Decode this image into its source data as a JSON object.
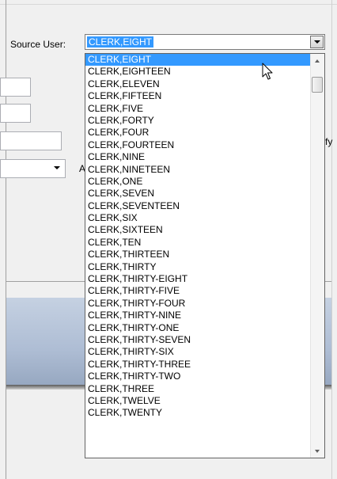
{
  "form": {
    "source_user_label": "Source User:",
    "partial_letter_a": "A",
    "partial_text_fy": "fy"
  },
  "source_user_combo": {
    "selected_value": "CLERK,EIGHT"
  },
  "dropdown": {
    "items": [
      "CLERK,EIGHT",
      "CLERK,EIGHTEEN",
      "CLERK,ELEVEN",
      "CLERK,FIFTEEN",
      "CLERK,FIVE",
      "CLERK,FORTY",
      "CLERK,FOUR",
      "CLERK,FOURTEEN",
      "CLERK,NINE",
      "CLERK,NINETEEN",
      "CLERK,ONE",
      "CLERK,SEVEN",
      "CLERK,SEVENTEEN",
      "CLERK,SIX",
      "CLERK,SIXTEEN",
      "CLERK,TEN",
      "CLERK,THIRTEEN",
      "CLERK,THIRTY",
      "CLERK,THIRTY-EIGHT",
      "CLERK,THIRTY-FIVE",
      "CLERK,THIRTY-FOUR",
      "CLERK,THIRTY-NINE",
      "CLERK,THIRTY-ONE",
      "CLERK,THIRTY-SEVEN",
      "CLERK,THIRTY-SIX",
      "CLERK,THIRTY-THREE",
      "CLERK,THIRTY-TWO",
      "CLERK,THREE",
      "CLERK,TWELVE",
      "CLERK,TWENTY"
    ],
    "highlighted_index": 0
  },
  "colors": {
    "selection": "#3399ff",
    "window_bg": "#f0f0f0",
    "panel_band": "#aebdd4"
  },
  "icons": {
    "combo_arrow": "chevron-down-icon",
    "scroll_up": "scroll-up-icon",
    "scroll_down": "scroll-down-icon",
    "cursor": "mouse-pointer-icon"
  }
}
